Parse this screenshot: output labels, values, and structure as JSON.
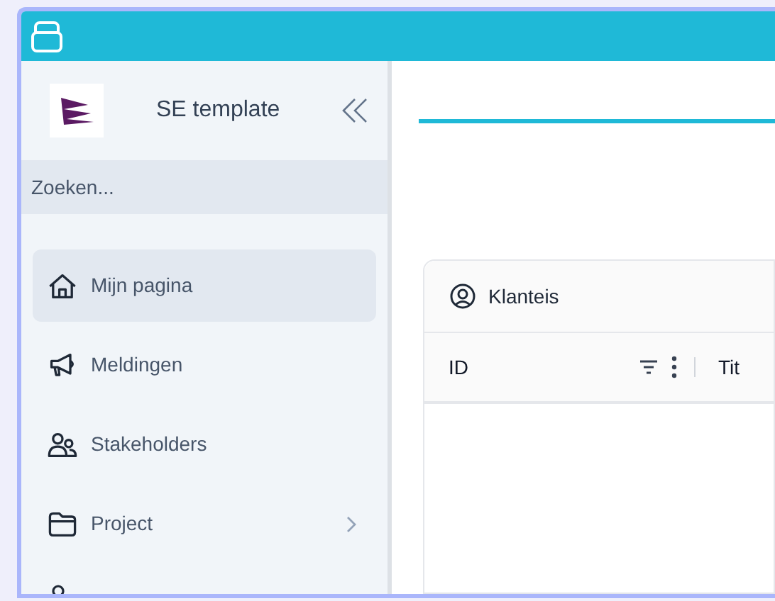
{
  "sidebar": {
    "brand": "SE template",
    "search": {
      "placeholder": "Zoeken..."
    },
    "items": [
      {
        "label": "Mijn pagina",
        "selected": true,
        "has_submenu": false
      },
      {
        "label": "Meldingen",
        "selected": false,
        "has_submenu": false
      },
      {
        "label": "Stakeholders",
        "selected": false,
        "has_submenu": false
      },
      {
        "label": "Project",
        "selected": false,
        "has_submenu": true
      }
    ]
  },
  "card": {
    "title": "Klanteis",
    "columns": [
      "ID",
      "Tit"
    ]
  }
}
